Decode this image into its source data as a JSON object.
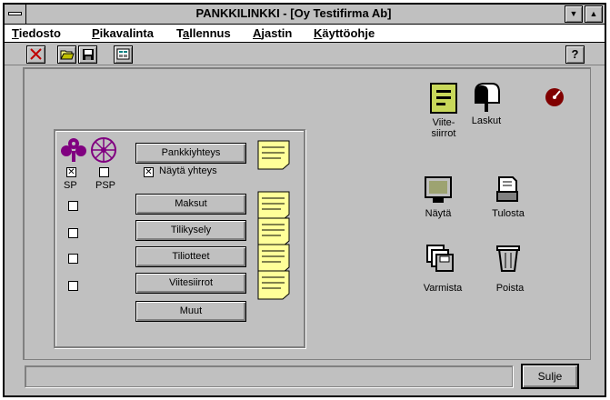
{
  "window": {
    "title": "PANKKILINKKI - [Oy Testifirma Ab]"
  },
  "menu": [
    {
      "accel": "T",
      "rest": "iedosto"
    },
    {
      "accel": "P",
      "rest": "ikavalinta"
    },
    {
      "pre": "T",
      "accel": "a",
      "rest": "llennus"
    },
    {
      "accel": "A",
      "rest": "jastin"
    },
    {
      "accel": "K",
      "rest": "äyttöohje"
    }
  ],
  "toolbar": {
    "help_label": "?"
  },
  "panel": {
    "sp_label": "SP",
    "psp_label": "PSP",
    "show_connection_label": "Näytä yhteys",
    "buttons": {
      "connection": "Pankkiyhteys",
      "payments": "Maksut",
      "account_query": "Tilikysely",
      "statements": "Tiliotteet",
      "reference_transfers": "Viitesiirrot",
      "other": "Muut"
    },
    "sp_checked": true,
    "psp_checked": false,
    "show_connection_checked": true
  },
  "icons": {
    "viitesiirrot": "Viite-\nsiirrot",
    "laskut": "Laskut",
    "nayta": "Näytä",
    "tulosta": "Tulosta",
    "varmista": "Varmista",
    "poista": "Poista"
  },
  "footer": {
    "status_text": "",
    "close_label": "Sulje"
  },
  "colors": {
    "face": "#c0c0c0",
    "note_yellow": "#ffff99",
    "purple": "#800080",
    "green_icon": "#c8d85a",
    "dark_red": "#800000"
  }
}
